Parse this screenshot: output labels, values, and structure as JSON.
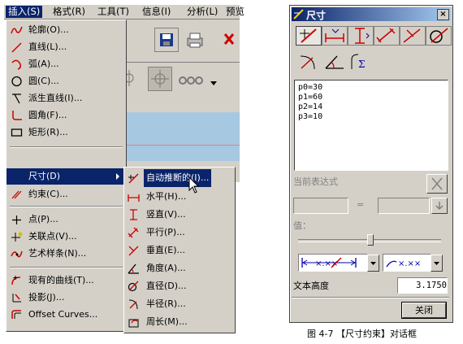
{
  "menubar": {
    "items": [
      "插入(S)",
      "格式(R)",
      "工具(T)",
      "信息(I)",
      "分析(L)",
      "预览"
    ]
  },
  "insert_menu": {
    "items": [
      {
        "label": "轮廓(O)...",
        "icon": "profile-icon"
      },
      {
        "label": "直线(L)...",
        "icon": "line-icon"
      },
      {
        "label": "弧(A)...",
        "icon": "arc-icon"
      },
      {
        "label": "圆(C)...",
        "icon": "circle-icon"
      },
      {
        "label": "派生直线(I)...",
        "icon": "derived-line-icon"
      },
      {
        "label": "圆角(F)...",
        "icon": "fillet-icon"
      },
      {
        "label": "矩形(R)...",
        "icon": "rectangle-icon"
      },
      {
        "label": "尺寸(D)",
        "icon": "dimension-icon"
      },
      {
        "label": "约束(C)...",
        "icon": "constraint-icon"
      },
      {
        "label": "点(P)...",
        "icon": "point-icon"
      },
      {
        "label": "关联点(V)...",
        "icon": "associative-point-icon"
      },
      {
        "label": "艺术样条(N)...",
        "icon": "spline-icon"
      },
      {
        "label": "现有的曲线(T)...",
        "icon": "existing-curve-icon"
      },
      {
        "label": "投影(J)...",
        "icon": "project-icon"
      },
      {
        "label": "Offset Curves...",
        "icon": "offset-curves-icon"
      }
    ]
  },
  "dimension_submenu": {
    "items": [
      {
        "label": "自动推断的(I)...",
        "icon": "inferred-dim-icon"
      },
      {
        "label": "水平(H)...",
        "icon": "horizontal-dim-icon"
      },
      {
        "label": "竖直(V)...",
        "icon": "vertical-dim-icon"
      },
      {
        "label": "平行(P)...",
        "icon": "parallel-dim-icon"
      },
      {
        "label": "垂直(E)...",
        "icon": "perpendicular-dim-icon"
      },
      {
        "label": "角度(A)...",
        "icon": "angular-dim-icon"
      },
      {
        "label": "直径(D)...",
        "icon": "diameter-dim-icon"
      },
      {
        "label": "半径(R)...",
        "icon": "radius-dim-icon"
      },
      {
        "label": "周长(M)...",
        "icon": "perimeter-dim-icon"
      }
    ]
  },
  "dialog": {
    "title": "尺寸",
    "close_glyph": "×",
    "expressions": [
      "p0=30",
      "p1=60",
      "p2=14",
      "p3=10"
    ],
    "current_expr_label": "当前表达式",
    "equals": "=",
    "value_label": "值：",
    "text_height_label": "文本高度",
    "text_height_value": "3.1750",
    "close_button": "关闭"
  },
  "caption": "图 4-7 【尺寸约束】对话框"
}
